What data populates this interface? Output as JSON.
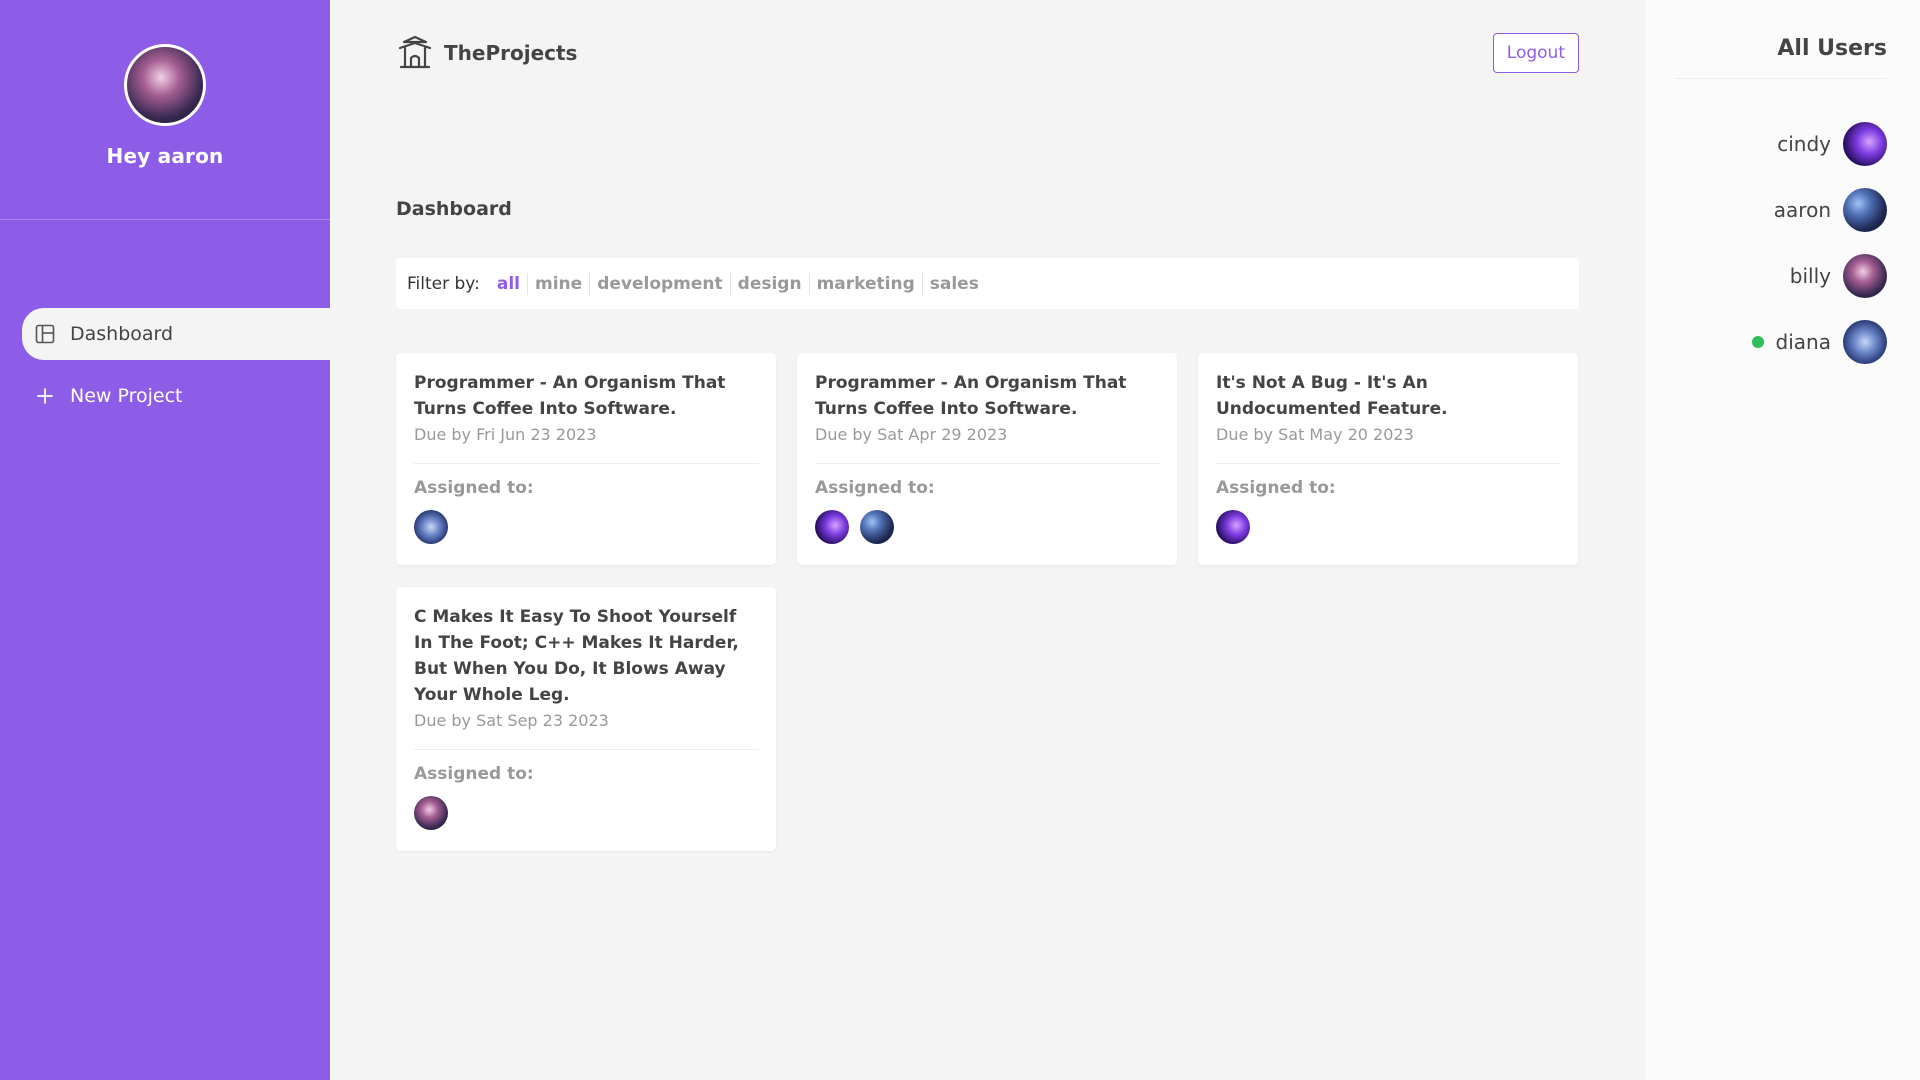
{
  "sidebar": {
    "greeting": "Hey aaron",
    "nav": [
      {
        "label": "Dashboard",
        "icon": "dashboard-icon",
        "active": true
      },
      {
        "label": "New Project",
        "icon": "plus-icon",
        "active": false
      }
    ]
  },
  "header": {
    "brand": "TheProjects",
    "brand_icon": "temple-icon",
    "logout_label": "Logout"
  },
  "main": {
    "title": "Dashboard",
    "filter": {
      "label": "Filter by:",
      "options": [
        "all",
        "mine",
        "development",
        "design",
        "marketing",
        "sales"
      ],
      "active": "all"
    },
    "assigned_label": "Assigned to:",
    "projects": [
      {
        "title": "Programmer - An Organism That Turns Coffee Into Software.",
        "due": "Due by Fri Jun 23 2023"
      },
      {
        "title": "Programmer - An Organism That Turns Coffee Into Software.",
        "due": "Due by Sat Apr 29 2023"
      },
      {
        "title": "It's Not A Bug - It's An Undocumented Feature.",
        "due": "Due by Sat May 20 2023"
      },
      {
        "title": "C Makes It Easy To Shoot Yourself In The Foot; C++ Makes It Harder, But When You Do, It Blows Away Your Whole Leg.",
        "due": "Due by Sat Sep 23 2023"
      }
    ]
  },
  "users": {
    "title": "All Users",
    "list": [
      {
        "name": "cindy",
        "online": false
      },
      {
        "name": "aaron",
        "online": false
      },
      {
        "name": "billy",
        "online": false
      },
      {
        "name": "diana",
        "online": true
      }
    ]
  },
  "colors": {
    "accent": "#8d5de8",
    "online": "#2fbe5a",
    "background": "#f4f4f4"
  }
}
